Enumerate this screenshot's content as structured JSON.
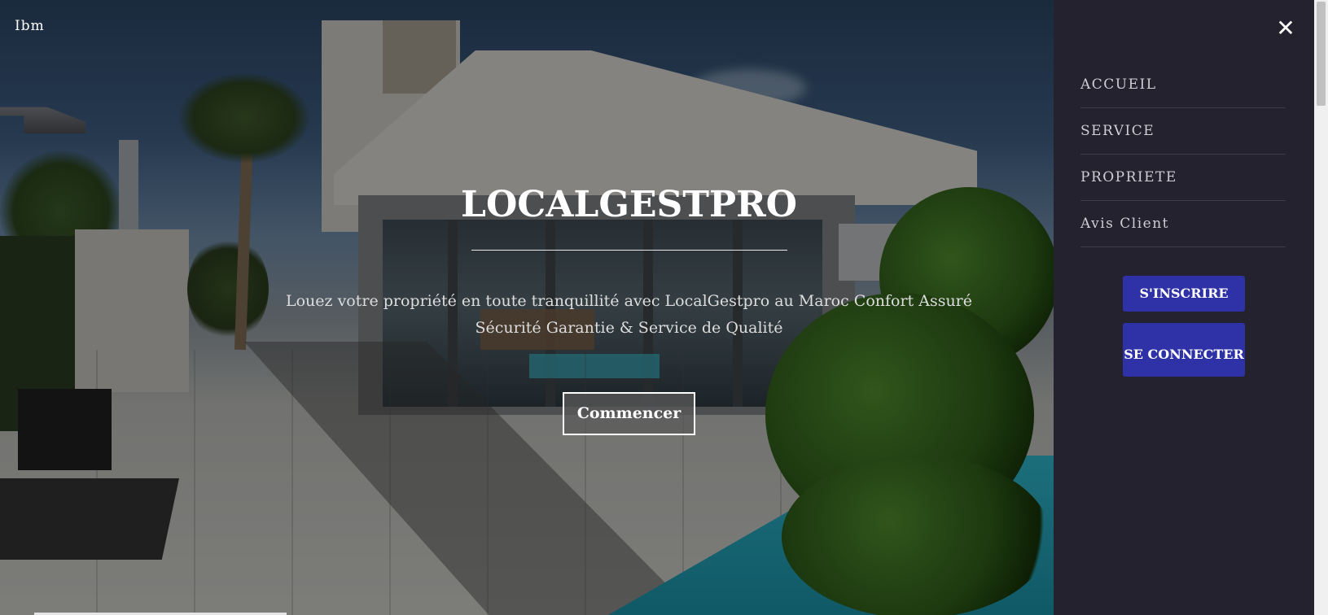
{
  "header": {
    "brand": "Ibm"
  },
  "hero": {
    "title": "LOCALGESTPRO",
    "subtitle": "Louez votre propriété en toute tranquillité avec LocalGestpro au Maroc Confort Assuré Sécurité Garantie & Service de Qualité",
    "cta_label": "Commencer"
  },
  "sidebar": {
    "close_icon": "close-icon",
    "items": [
      {
        "label": "ACCUEIL"
      },
      {
        "label": "SERVICE"
      },
      {
        "label": "PROPRIETE"
      },
      {
        "label": "Avis Client"
      }
    ],
    "signup_label": "S'INSCRIRE",
    "login_label": "SE CONNECTER"
  },
  "colors": {
    "sidebar_bg": "#25222f",
    "button_blue": "#2f32a6",
    "text_white": "#ffffff"
  }
}
